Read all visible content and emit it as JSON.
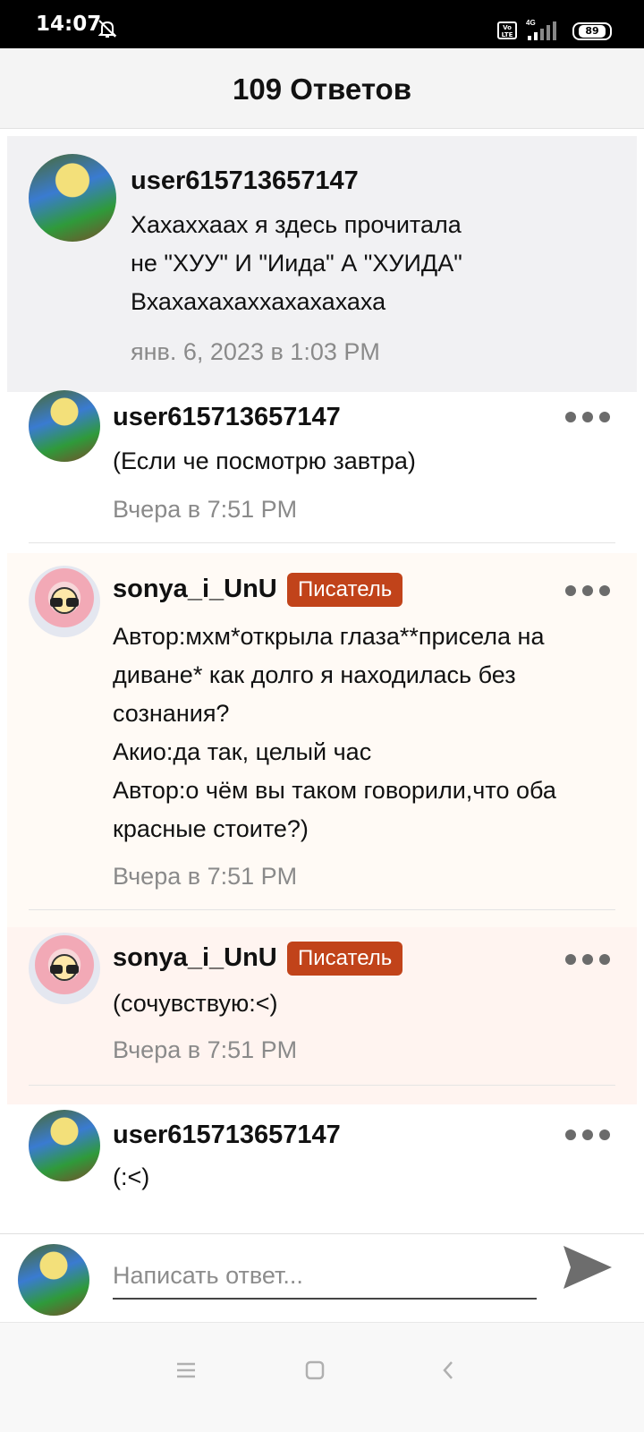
{
  "status_bar": {
    "time": "14:07",
    "volte_label": "Vo LTE",
    "network": "4G",
    "battery": "89"
  },
  "header": {
    "title": "109 Ответов"
  },
  "parent_comment": {
    "username": "user615713657147",
    "text": "Хахаххаах я здесь прочитала\nне \"ХУУ\" И \"Иида\" А \"ХУИДА\"\nВхахахахаххахахахаха",
    "timestamp": "янв. 6, 2023 в 1:03 PM"
  },
  "replies": [
    {
      "username": "user615713657147",
      "text": "(Если че посмотрю завтра)",
      "timestamp": "Вчера в 7:51 PM"
    },
    {
      "username": "sonya_i_UnU",
      "badge": "Писатель",
      "text": "Автор:мхм*открыла глаза**присела на\nдиване* как долго я находилась без\nсознания?\nАкио:да так, целый час\nАвтор:о чём вы таком говорили,что оба\nкрасные стоите?)",
      "timestamp": "Вчера в 7:51 PM"
    },
    {
      "username": "sonya_i_UnU",
      "badge": "Писатель",
      "text": "(сочувствую:<)",
      "timestamp": "Вчера в 7:51 PM"
    },
    {
      "username": "user615713657147",
      "text": "(:<)"
    }
  ],
  "reply_bar": {
    "placeholder": "Написать ответ..."
  },
  "icons": {
    "more": "more-dots-icon",
    "send": "send-icon",
    "nav_menu": "menu-icon",
    "nav_home": "home-square-icon",
    "nav_back": "back-chevron-icon"
  },
  "colors": {
    "badge": "#c1431a",
    "parent_bg": "#f1f1f3",
    "writer_bg": "#fffaf5",
    "writer_bg_2": "#fff4f0"
  }
}
